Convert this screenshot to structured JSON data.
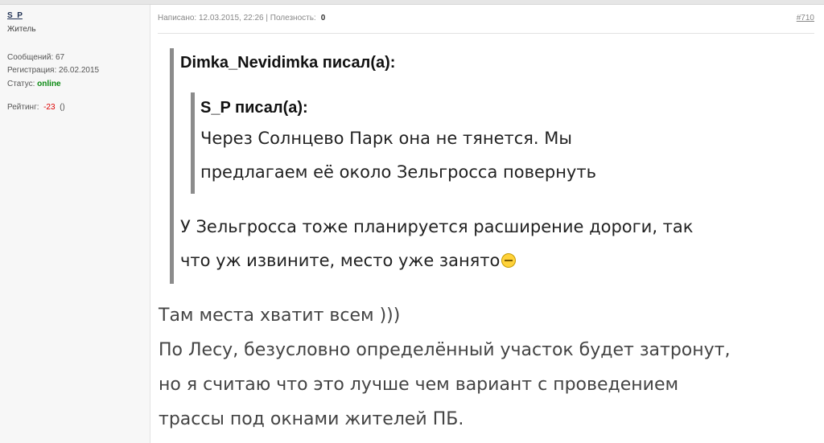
{
  "user": {
    "name": "S_P",
    "rank": "Житель",
    "messages": "Сообщений: 67",
    "registered": "Регистрация: 26.02.2015",
    "status_label": "Статус:",
    "status_value": "online",
    "rating_label": "Рейтинг:",
    "rating_value": "-23",
    "rating_extra": "()"
  },
  "post": {
    "meta": "Написано: 12.03.2015, 22:26 | Полезность:",
    "usefulness": "0",
    "number": "#710",
    "quote_outer": {
      "author": "Dimka_Nevidimka писал(а):",
      "inner": {
        "author": "S_P писал(а):",
        "line1": "Через Солнцево Парк она не тянется. Мы",
        "line2": "предлагаем её около Зельгросса повернуть"
      },
      "line1": "У Зельгросса тоже планируется расширение дороги, так",
      "line2": "что уж извините, место уже занято",
      "smiley_icon": "smiley-icon"
    },
    "body": [
      "Там места хватит всем )))",
      "По Лесу, безусловно определённый участок будет затронут,",
      "но я считаю что это лучше чем вариант с проведением",
      "трассы под окнами жителей ПБ."
    ]
  }
}
